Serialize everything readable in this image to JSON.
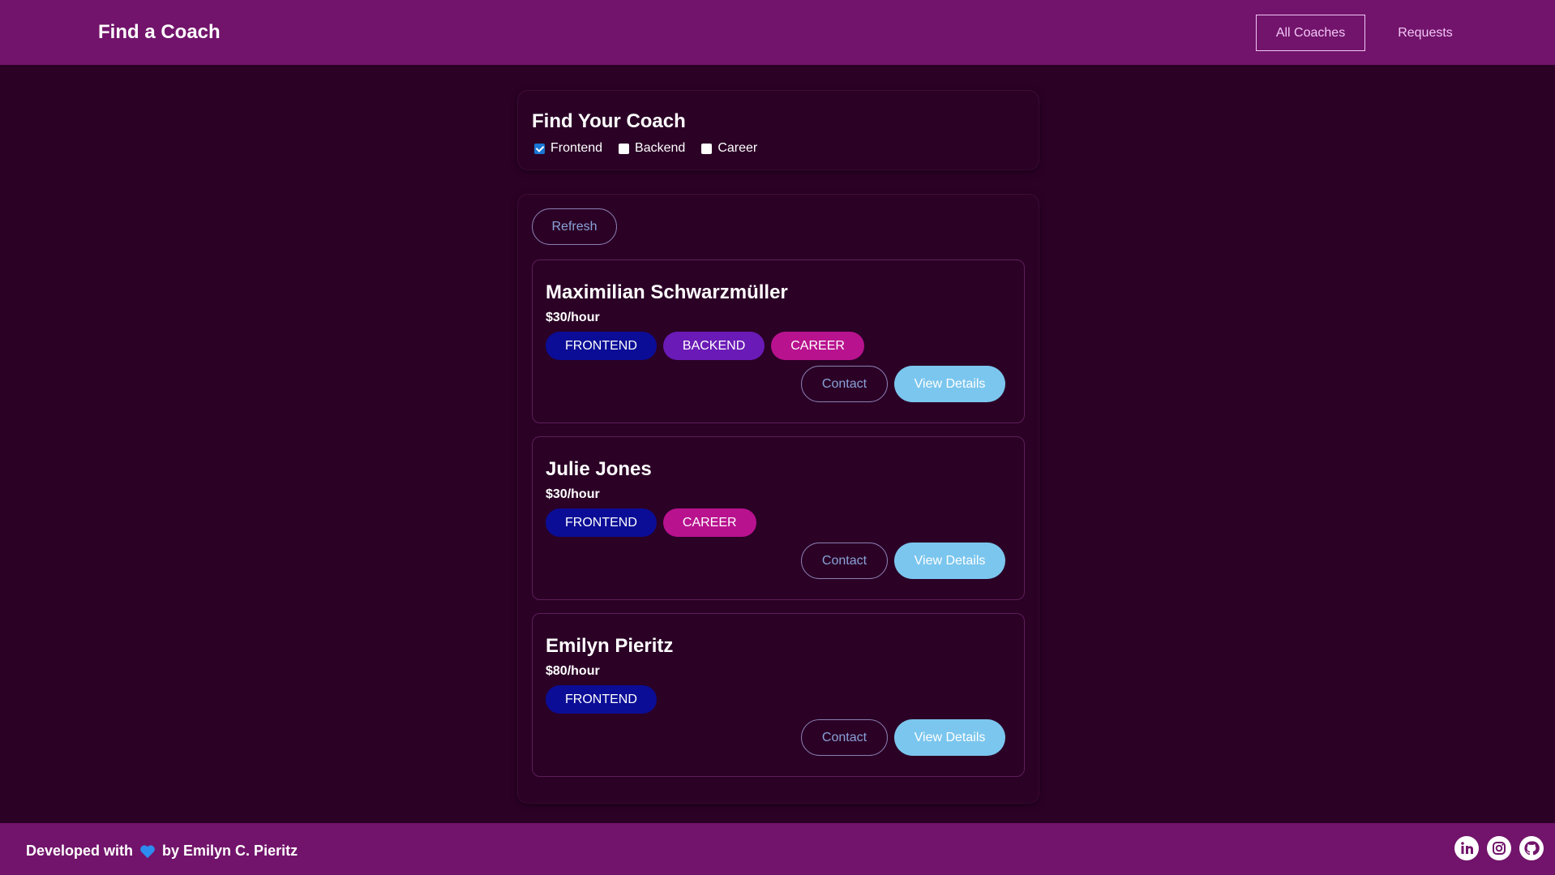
{
  "header": {
    "title": "Find a Coach",
    "nav": {
      "all_coaches": "All Coaches",
      "requests": "Requests"
    }
  },
  "filter": {
    "title": "Find Your Coach",
    "options": [
      {
        "label": "Frontend",
        "checked": true
      },
      {
        "label": "Backend",
        "checked": false
      },
      {
        "label": "Career",
        "checked": false
      }
    ]
  },
  "list": {
    "refresh_label": "Refresh",
    "coaches": [
      {
        "name": "Maximilian Schwarzmüller",
        "rate": "$30/hour",
        "areas": [
          "FRONTEND",
          "BACKEND",
          "CAREER"
        ],
        "contact_label": "Contact",
        "details_label": "View Details"
      },
      {
        "name": "Julie Jones",
        "rate": "$30/hour",
        "areas": [
          "FRONTEND",
          "CAREER"
        ],
        "contact_label": "Contact",
        "details_label": "View Details"
      },
      {
        "name": "Emilyn Pieritz",
        "rate": "$80/hour",
        "areas": [
          "FRONTEND"
        ],
        "contact_label": "Contact",
        "details_label": "View Details"
      }
    ]
  },
  "footer": {
    "text_before": "Developed with",
    "text_after": "by Emilyn C. Pieritz",
    "icons": [
      "heart-icon",
      "linkedin-icon",
      "instagram-icon",
      "github-icon"
    ]
  },
  "colors": {
    "header_bg": "#72146b",
    "page_bg": "#2b0126",
    "frontend_badge": "#0b0d96",
    "backend_badge": "#6a1ab6",
    "career_badge": "#b8128e",
    "details_button": "#7bc6ee"
  }
}
